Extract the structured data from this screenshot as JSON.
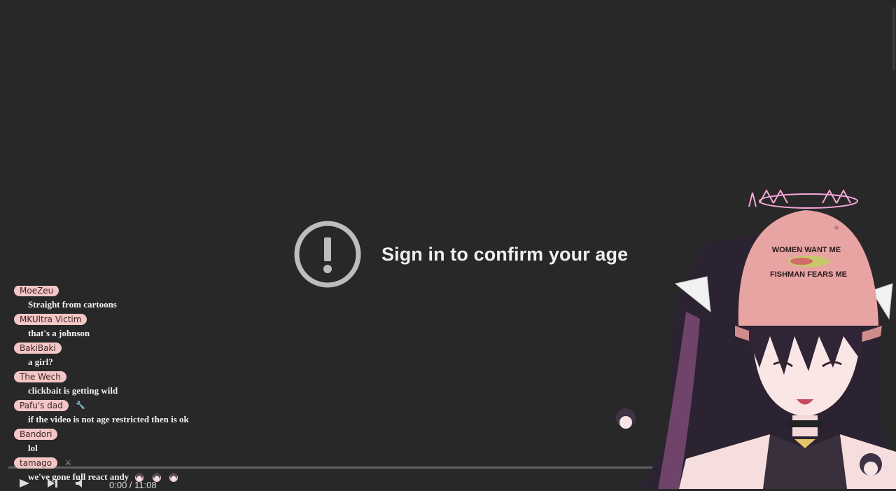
{
  "player": {
    "age_message": "Sign in to confirm your age",
    "time": "0:00 / 11:08",
    "progress": 0.0
  },
  "chat": {
    "messages": [
      {
        "author": "MoeZeu",
        "text": "Straight from cartoons"
      },
      {
        "author": "MKUltra Victim",
        "text": "that's a johnson"
      },
      {
        "author": "BakiBaki",
        "text": "a girl?"
      },
      {
        "author": "The Wech",
        "text": "clickbait is getting wild"
      },
      {
        "author": "Pafu's dad",
        "text": "if the video is not age restricted then is ok",
        "badge": "wrench-icon"
      },
      {
        "author": "Bandori",
        "text": "lol"
      },
      {
        "author": "tamago",
        "text": "we've gone full react andy",
        "badge": "sword-icon",
        "emotes": [
          "emote-chibi",
          "emote-chibi",
          "emote-chibi"
        ]
      }
    ]
  },
  "avatar": {
    "cap_text_line1": "WOMEN WANT ME",
    "cap_text_line2": "FISHMAN FEARS ME"
  },
  "colors": {
    "background": "#282828",
    "chat_name_bg": "#f4c6c6",
    "cap": "#e8a3a3",
    "hair": "#2b2232"
  }
}
